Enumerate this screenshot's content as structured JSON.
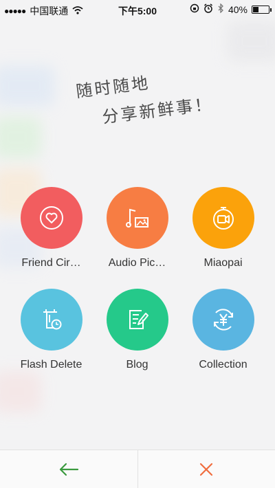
{
  "status_bar": {
    "carrier": "中国联通",
    "time": "下午5:00",
    "battery": "40%",
    "battery_level": 0.4
  },
  "slogan": {
    "line1": "随时随地",
    "line2": "分享新鲜事！"
  },
  "share_items": [
    {
      "label": "Friend Cir…",
      "icon": "heart-icon",
      "color": "#f25d5f"
    },
    {
      "label": "Audio Pic…",
      "icon": "music-photo-icon",
      "color": "#f77d43"
    },
    {
      "label": "Miaopai",
      "icon": "timer-video-icon",
      "color": "#fba20b"
    },
    {
      "label": "Flash Delete",
      "icon": "clock-delete-icon",
      "color": "#59c3df"
    },
    {
      "label": "Blog",
      "icon": "edit-note-icon",
      "color": "#25c98a"
    },
    {
      "label": "Collection",
      "icon": "yuan-refresh-icon",
      "color": "#5ab5e1"
    }
  ],
  "bottom_bar": {
    "back_icon": "arrow-left-icon",
    "close_icon": "close-icon",
    "back_color": "#3a9a3e",
    "close_color": "#f06d3e"
  }
}
